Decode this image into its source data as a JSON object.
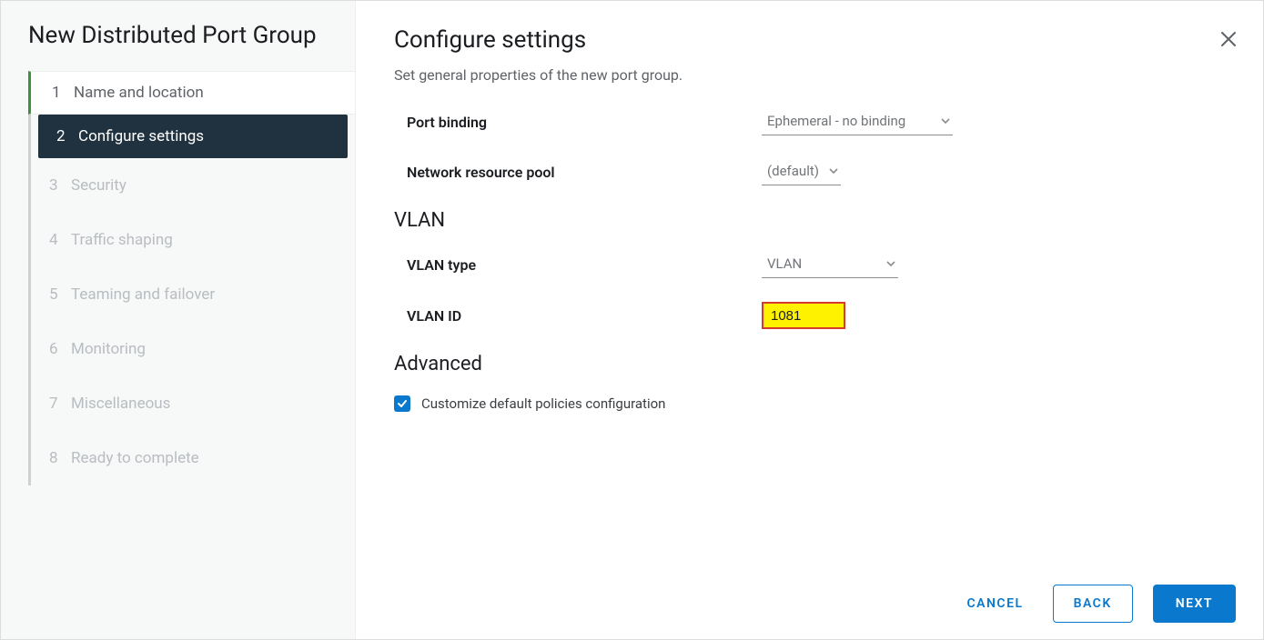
{
  "sidebar": {
    "title": "New Distributed Port Group",
    "steps": [
      {
        "num": "1",
        "label": "Name and location"
      },
      {
        "num": "2",
        "label": "Configure settings"
      },
      {
        "num": "3",
        "label": "Security"
      },
      {
        "num": "4",
        "label": "Traffic shaping"
      },
      {
        "num": "5",
        "label": "Teaming and failover"
      },
      {
        "num": "6",
        "label": "Monitoring"
      },
      {
        "num": "7",
        "label": "Miscellaneous"
      },
      {
        "num": "8",
        "label": "Ready to complete"
      }
    ]
  },
  "main": {
    "title": "Configure settings",
    "subtitle": "Set general properties of the new port group.",
    "port_binding_label": "Port binding",
    "port_binding_value": "Ephemeral - no binding",
    "net_pool_label": "Network resource pool",
    "net_pool_value": "(default)",
    "vlan_header": "VLAN",
    "vlan_type_label": "VLAN type",
    "vlan_type_value": "VLAN",
    "vlan_id_label": "VLAN ID",
    "vlan_id_value": "1081",
    "advanced_header": "Advanced",
    "customize_label": "Customize default policies configuration",
    "customize_checked": true
  },
  "footer": {
    "cancel": "CANCEL",
    "back": "BACK",
    "next": "NEXT"
  }
}
